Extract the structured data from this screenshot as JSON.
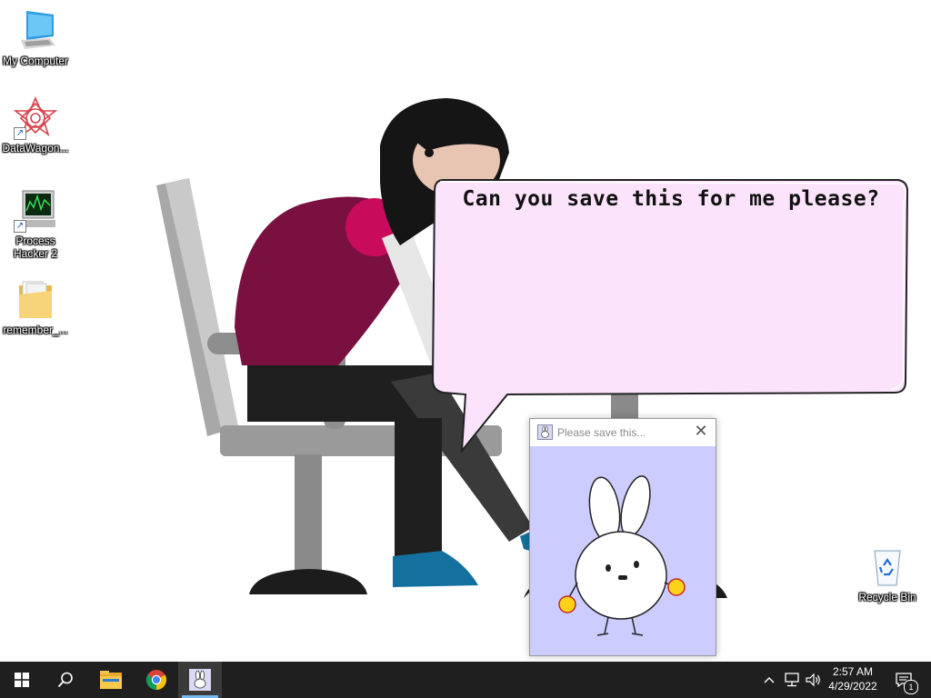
{
  "desktop": {
    "icons": [
      {
        "label": "My Computer",
        "icon": "computer-icon"
      },
      {
        "label": "DataWagon...",
        "icon": "datawagon-icon"
      },
      {
        "label": "Process Hacker 2",
        "icon": "process-hacker-icon"
      },
      {
        "label": "remember_...",
        "icon": "folder-icon"
      }
    ],
    "recycle_bin": {
      "label": "Recycle Bin",
      "icon": "recycle-bin-icon"
    }
  },
  "speech_bubble": {
    "text": "Can you save this for me please?",
    "fill_color": "#fbe3fb",
    "border_color": "#222222"
  },
  "popup": {
    "title": "Please save this...",
    "close_label": "✕",
    "content_background": "#ccccff"
  },
  "taskbar": {
    "items": [
      {
        "name": "start",
        "icon": "windows-start-icon"
      },
      {
        "name": "search",
        "icon": "search-icon"
      },
      {
        "name": "file-explorer",
        "icon": "folder-icon"
      },
      {
        "name": "chrome",
        "icon": "chrome-icon"
      },
      {
        "name": "please-save-app",
        "icon": "bunny-app-icon",
        "active": true
      }
    ],
    "tray": {
      "chevron": "^",
      "time": "2:57 AM",
      "date": "4/29/2022",
      "notification_count": "1"
    },
    "accent_color": "#76b9ed"
  }
}
